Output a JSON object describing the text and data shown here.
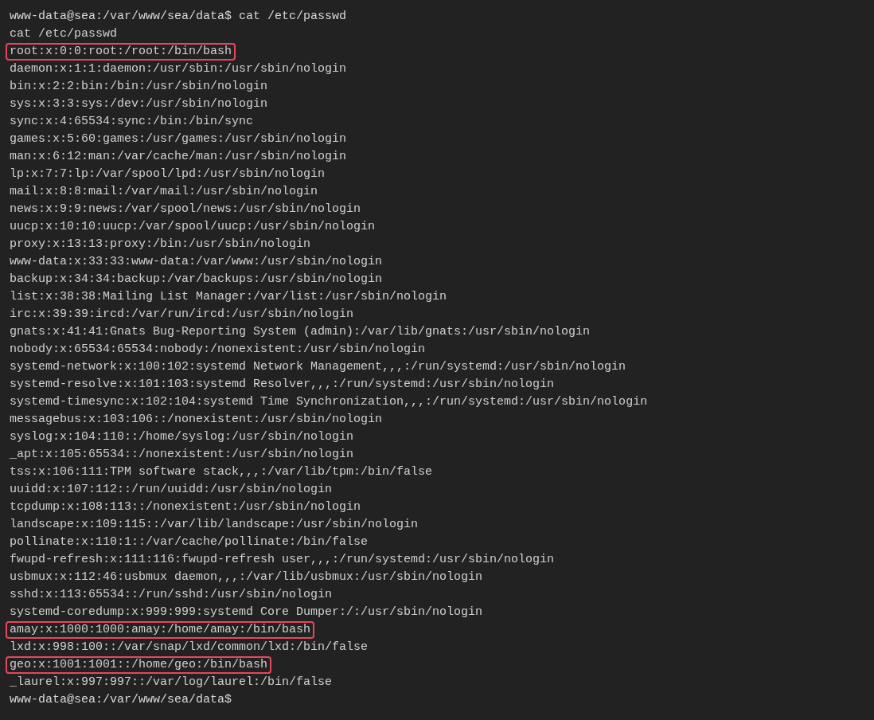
{
  "terminal": {
    "lines": [
      {
        "text": "www-data@sea:/var/www/sea/data$ cat /etc/passwd",
        "kind": "prompt",
        "highlighted": false
      },
      {
        "text": "cat /etc/passwd",
        "kind": "output",
        "highlighted": false
      },
      {
        "text": "root:x:0:0:root:/root:/bin/bash",
        "kind": "output",
        "highlighted": true
      },
      {
        "text": "daemon:x:1:1:daemon:/usr/sbin:/usr/sbin/nologin",
        "kind": "output",
        "highlighted": false
      },
      {
        "text": "bin:x:2:2:bin:/bin:/usr/sbin/nologin",
        "kind": "output",
        "highlighted": false
      },
      {
        "text": "sys:x:3:3:sys:/dev:/usr/sbin/nologin",
        "kind": "output",
        "highlighted": false
      },
      {
        "text": "sync:x:4:65534:sync:/bin:/bin/sync",
        "kind": "output",
        "highlighted": false
      },
      {
        "text": "games:x:5:60:games:/usr/games:/usr/sbin/nologin",
        "kind": "output",
        "highlighted": false
      },
      {
        "text": "man:x:6:12:man:/var/cache/man:/usr/sbin/nologin",
        "kind": "output",
        "highlighted": false
      },
      {
        "text": "lp:x:7:7:lp:/var/spool/lpd:/usr/sbin/nologin",
        "kind": "output",
        "highlighted": false
      },
      {
        "text": "mail:x:8:8:mail:/var/mail:/usr/sbin/nologin",
        "kind": "output",
        "highlighted": false
      },
      {
        "text": "news:x:9:9:news:/var/spool/news:/usr/sbin/nologin",
        "kind": "output",
        "highlighted": false
      },
      {
        "text": "uucp:x:10:10:uucp:/var/spool/uucp:/usr/sbin/nologin",
        "kind": "output",
        "highlighted": false
      },
      {
        "text": "proxy:x:13:13:proxy:/bin:/usr/sbin/nologin",
        "kind": "output",
        "highlighted": false
      },
      {
        "text": "www-data:x:33:33:www-data:/var/www:/usr/sbin/nologin",
        "kind": "output",
        "highlighted": false
      },
      {
        "text": "backup:x:34:34:backup:/var/backups:/usr/sbin/nologin",
        "kind": "output",
        "highlighted": false
      },
      {
        "text": "list:x:38:38:Mailing List Manager:/var/list:/usr/sbin/nologin",
        "kind": "output",
        "highlighted": false
      },
      {
        "text": "irc:x:39:39:ircd:/var/run/ircd:/usr/sbin/nologin",
        "kind": "output",
        "highlighted": false
      },
      {
        "text": "gnats:x:41:41:Gnats Bug-Reporting System (admin):/var/lib/gnats:/usr/sbin/nologin",
        "kind": "output",
        "highlighted": false
      },
      {
        "text": "nobody:x:65534:65534:nobody:/nonexistent:/usr/sbin/nologin",
        "kind": "output",
        "highlighted": false
      },
      {
        "text": "systemd-network:x:100:102:systemd Network Management,,,:/run/systemd:/usr/sbin/nologin",
        "kind": "output",
        "highlighted": false
      },
      {
        "text": "systemd-resolve:x:101:103:systemd Resolver,,,:/run/systemd:/usr/sbin/nologin",
        "kind": "output",
        "highlighted": false
      },
      {
        "text": "systemd-timesync:x:102:104:systemd Time Synchronization,,,:/run/systemd:/usr/sbin/nologin",
        "kind": "output",
        "highlighted": false
      },
      {
        "text": "messagebus:x:103:106::/nonexistent:/usr/sbin/nologin",
        "kind": "output",
        "highlighted": false
      },
      {
        "text": "syslog:x:104:110::/home/syslog:/usr/sbin/nologin",
        "kind": "output",
        "highlighted": false
      },
      {
        "text": "_apt:x:105:65534::/nonexistent:/usr/sbin/nologin",
        "kind": "output",
        "highlighted": false
      },
      {
        "text": "tss:x:106:111:TPM software stack,,,:/var/lib/tpm:/bin/false",
        "kind": "output",
        "highlighted": false
      },
      {
        "text": "uuidd:x:107:112::/run/uuidd:/usr/sbin/nologin",
        "kind": "output",
        "highlighted": false
      },
      {
        "text": "tcpdump:x:108:113::/nonexistent:/usr/sbin/nologin",
        "kind": "output",
        "highlighted": false
      },
      {
        "text": "landscape:x:109:115::/var/lib/landscape:/usr/sbin/nologin",
        "kind": "output",
        "highlighted": false
      },
      {
        "text": "pollinate:x:110:1::/var/cache/pollinate:/bin/false",
        "kind": "output",
        "highlighted": false
      },
      {
        "text": "fwupd-refresh:x:111:116:fwupd-refresh user,,,:/run/systemd:/usr/sbin/nologin",
        "kind": "output",
        "highlighted": false
      },
      {
        "text": "usbmux:x:112:46:usbmux daemon,,,:/var/lib/usbmux:/usr/sbin/nologin",
        "kind": "output",
        "highlighted": false
      },
      {
        "text": "sshd:x:113:65534::/run/sshd:/usr/sbin/nologin",
        "kind": "output",
        "highlighted": false
      },
      {
        "text": "systemd-coredump:x:999:999:systemd Core Dumper:/:/usr/sbin/nologin",
        "kind": "output",
        "highlighted": false
      },
      {
        "text": "amay:x:1000:1000:amay:/home/amay:/bin/bash",
        "kind": "output",
        "highlighted": true
      },
      {
        "text": "lxd:x:998:100::/var/snap/lxd/common/lxd:/bin/false",
        "kind": "output",
        "highlighted": false
      },
      {
        "text": "geo:x:1001:1001::/home/geo:/bin/bash",
        "kind": "output",
        "highlighted": true
      },
      {
        "text": "_laurel:x:997:997::/var/log/laurel:/bin/false",
        "kind": "output",
        "highlighted": false
      },
      {
        "text": "www-data@sea:/var/www/sea/data$",
        "kind": "prompt",
        "highlighted": false
      }
    ]
  }
}
